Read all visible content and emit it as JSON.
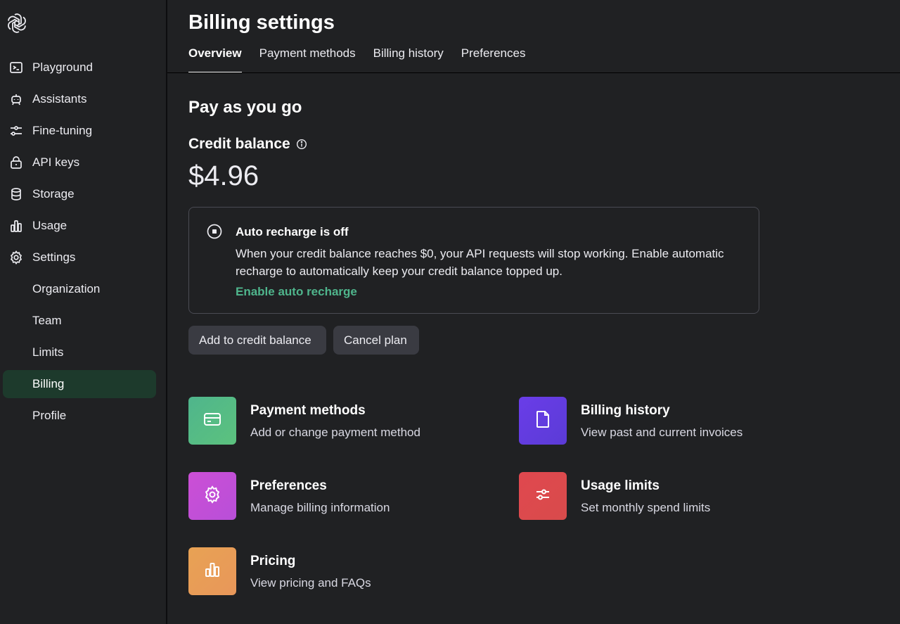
{
  "sidebar": {
    "items": [
      {
        "label": "Playground",
        "icon": "terminal-icon"
      },
      {
        "label": "Assistants",
        "icon": "robot-icon"
      },
      {
        "label": "Fine-tuning",
        "icon": "sliders-icon"
      },
      {
        "label": "API keys",
        "icon": "lock-icon"
      },
      {
        "label": "Storage",
        "icon": "database-icon"
      },
      {
        "label": "Usage",
        "icon": "bar-chart-icon"
      },
      {
        "label": "Settings",
        "icon": "gear-icon"
      }
    ],
    "settings_items": [
      {
        "label": "Organization"
      },
      {
        "label": "Team"
      },
      {
        "label": "Limits"
      },
      {
        "label": "Billing",
        "active": true
      },
      {
        "label": "Profile"
      }
    ]
  },
  "header": {
    "title": "Billing settings",
    "tabs": [
      {
        "label": "Overview",
        "active": true
      },
      {
        "label": "Payment methods"
      },
      {
        "label": "Billing history"
      },
      {
        "label": "Preferences"
      }
    ]
  },
  "overview": {
    "section_title": "Pay as you go",
    "credit_title": "Credit balance",
    "balance": "$4.96",
    "recharge": {
      "title": "Auto recharge is off",
      "description": "When your credit balance reaches $0, your API requests will stop working. Enable automatic recharge to automatically keep your credit balance topped up.",
      "link": "Enable auto recharge"
    },
    "buttons": {
      "add": "Add to credit balance",
      "cancel": "Cancel plan"
    }
  },
  "cards": [
    {
      "title": "Payment methods",
      "desc": "Add or change payment method",
      "icon": "credit-card-icon",
      "color": "#4fb58c"
    },
    {
      "title": "Billing history",
      "desc": "View past and current invoices",
      "icon": "document-icon",
      "color": "#6a3de8"
    },
    {
      "title": "Preferences",
      "desc": "Manage billing information",
      "icon": "gear-icon",
      "color": "#cc4fd6"
    },
    {
      "title": "Usage limits",
      "desc": "Set monthly spend limits",
      "icon": "sliders-icon",
      "color": "#e0484f"
    },
    {
      "title": "Pricing",
      "desc": "View pricing and FAQs",
      "icon": "bar-chart-icon",
      "color": "#e8a254"
    }
  ],
  "colors": {
    "accent_green": "#4fb58c",
    "active_nav_bg": "#1d3a2c",
    "background": "#202123",
    "button_bg": "#3a3b42"
  }
}
